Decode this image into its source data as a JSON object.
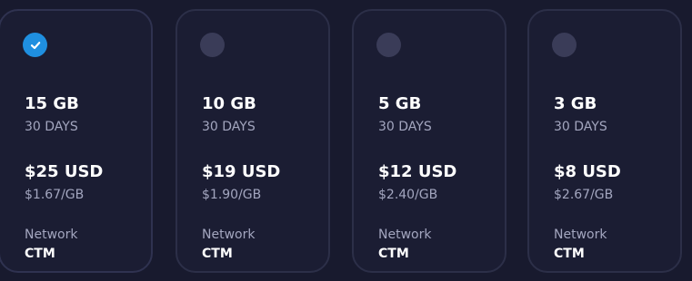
{
  "plans": [
    {
      "selected": true,
      "data": "15 GB",
      "duration": "30 DAYS",
      "price": "$25 USD",
      "unit_price": "$1.67/GB",
      "network_label": "Network",
      "network": "CTM"
    },
    {
      "selected": false,
      "data": "10 GB",
      "duration": "30 DAYS",
      "price": "$19 USD",
      "unit_price": "$1.90/GB",
      "network_label": "Network",
      "network": "CTM"
    },
    {
      "selected": false,
      "data": "5 GB",
      "duration": "30 DAYS",
      "price": "$12 USD",
      "unit_price": "$2.40/GB",
      "network_label": "Network",
      "network": "CTM"
    },
    {
      "selected": false,
      "data": "3 GB",
      "duration": "30 DAYS",
      "price": "$8 USD",
      "unit_price": "$2.67/GB",
      "network_label": "Network",
      "network": "CTM"
    }
  ],
  "colors": {
    "background": "#181a2e",
    "card": "#1b1d33",
    "accent": "#1f8fe0",
    "radio_unchecked": "#3a3c58"
  },
  "icons": {
    "checked": "checkmark-icon"
  }
}
